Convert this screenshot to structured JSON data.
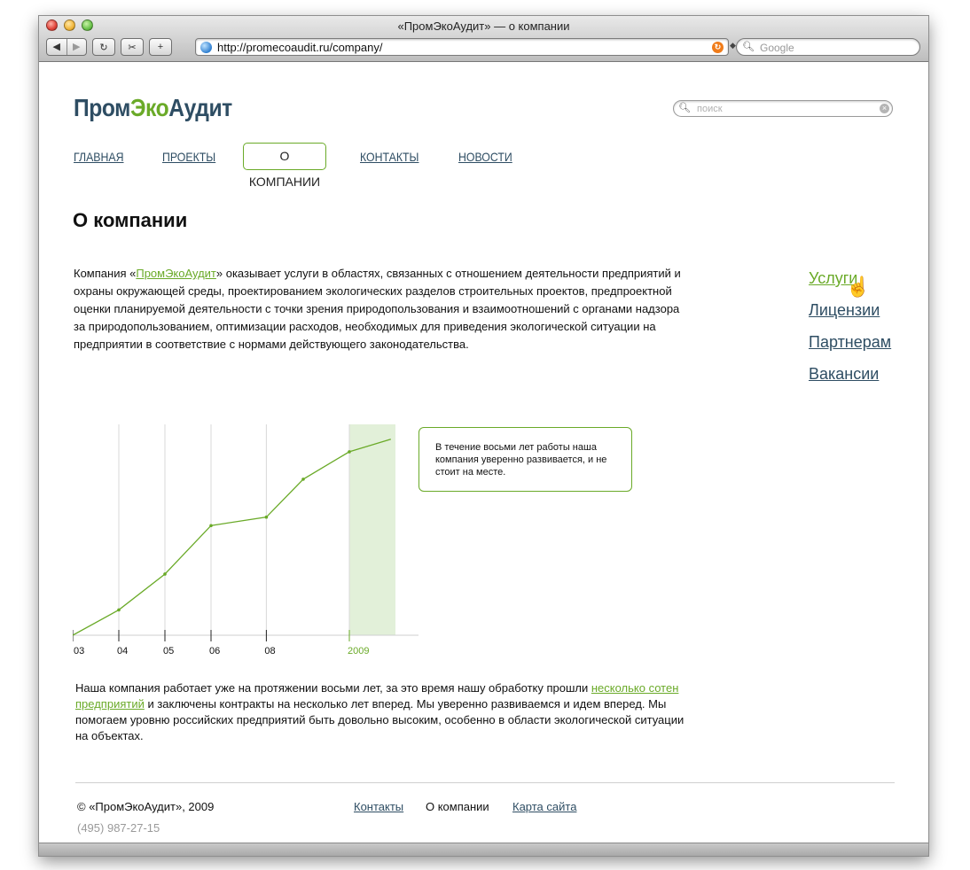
{
  "browser": {
    "window_title": "«ПромЭкоАудит» — о компании",
    "back_label": "◀",
    "forward_label": "▶",
    "reload_label": "↻",
    "snap_label": "✂",
    "add_label": "+",
    "url": "http://promecoaudit.ru/company/",
    "search_placeholder": "Google"
  },
  "site": {
    "logo_prom": "Пром",
    "logo_eco": "Эко",
    "logo_audit": "Аудит",
    "search_placeholder": "поиск",
    "brand_color": "#2e4d63",
    "accent_color": "#6aaa28"
  },
  "nav": {
    "items": [
      {
        "label": "ГЛАВНАЯ"
      },
      {
        "label": "ПРОЕКТЫ"
      },
      {
        "label": "О КОМПАНИИ",
        "active": true
      },
      {
        "label": "КОНТАКТЫ"
      },
      {
        "label": "НОВОСТИ"
      }
    ]
  },
  "content": {
    "page_title": "О компании",
    "intro_before": "Компания «",
    "intro_link": "ПромЭкоАудит",
    "intro_after": "» оказывает услуги в областях, связанных с отношением деятельности предприятий и охраны окружающей среды, проектированием экологических разделов строительных проектов, предпроектной оценки планируемой деятельности с точки зрения природопользования и взаимоотношений с органами надзора за природопользованием, оптимизации расходов, необходимых для приведения экологической ситуации на предприятии в соответствие с нормами действующего законодательства.",
    "callout_text": "В течение восьми лет работы наша компания уверенно развивается, и не стоит на месте.",
    "para2_before": "Наша компания работает уже на протяжении восьми лет, за это время нашу обработку прошли ",
    "para2_link": "несколько сотен предприятий",
    "para2_after": " и заключены контракты на несколько лет вперед. Мы уверенно развиваемся и идем вперед. Мы помогаем уровню российских предприятий быть довольно высоким, особенно в области экологической ситуации на объектах."
  },
  "sidebar": {
    "items": [
      {
        "label": "Услуги",
        "hover": true
      },
      {
        "label": "Лицензии"
      },
      {
        "label": "Партнерам"
      },
      {
        "label": "Вакансии"
      }
    ]
  },
  "chart_data": {
    "type": "line",
    "tick_labels": [
      "03",
      "04",
      "05",
      "06",
      "08",
      "2009"
    ],
    "highlight_label": "2009",
    "x": [
      2003,
      2004,
      2005,
      2006,
      2007.2,
      2008,
      2009,
      2009.9
    ],
    "y": [
      0,
      12,
      29,
      52,
      56,
      74,
      87,
      93
    ],
    "xlim": [
      2003,
      2010.5
    ],
    "ylim": [
      0,
      100
    ],
    "highlight_range": [
      2009,
      2010
    ],
    "line_color": "#6aaa28",
    "highlight_color": "#e2f0d9",
    "grid": true
  },
  "footer": {
    "copyright": "© «ПромЭкоАудит», 2009",
    "phone": "(495) 987-27-15",
    "links": [
      {
        "label": "Контакты"
      },
      {
        "label": "О компании",
        "current": true
      },
      {
        "label": "Карта сайта"
      }
    ]
  }
}
